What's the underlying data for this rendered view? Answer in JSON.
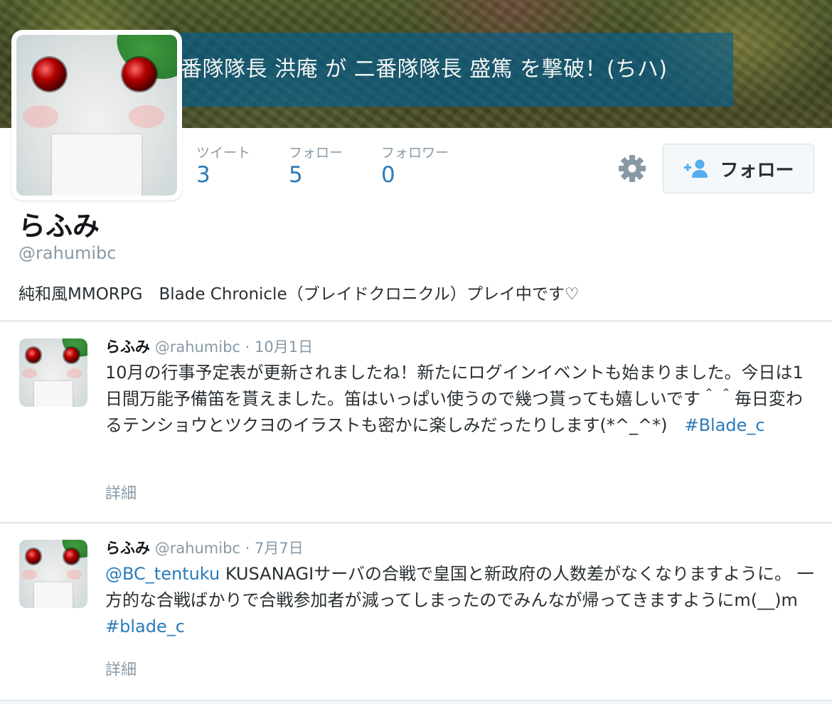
{
  "banner": {
    "message": "番隊隊長  洪庵 が 二番隊隊長  盛篤 を撃破！(ちハ)"
  },
  "profile": {
    "avatar_icon": "character-avatar",
    "stats": [
      {
        "label": "ツイート",
        "value": "3"
      },
      {
        "label": "フォロー",
        "value": "5"
      },
      {
        "label": "フォロワー",
        "value": "0"
      }
    ],
    "settings_icon": "gear-icon",
    "follow_button": {
      "icon": "add-user-icon",
      "label": "フォロー"
    },
    "name": "らふみ",
    "handle": "@rahumibc",
    "bio": "純和風MMORPG　Blade Chronicle（ブレイドクロニクル）プレイ中です♡"
  },
  "tweets": [
    {
      "name": "らふみ",
      "handle": "@rahumibc",
      "separator": "·",
      "date": "10月1日",
      "text": "10月の行事予定表が更新されましたね！新たにログインイベントも始まりました。今日は1日間万能予備笛を貰えました。笛はいっぱい使うので幾つ貰っても嬉しいです＾＾毎日変わるテンショウとツクヨのイラストも密かに楽しみだったりします(*^_^*)　",
      "hashtag": "#Blade_c",
      "details": "詳細"
    },
    {
      "name": "らふみ",
      "handle": "@rahumibc",
      "separator": "·",
      "date": "7月7日",
      "mention": "@BC_tentuku",
      "text": " KUSANAGIサーバの合戦で皇国と新政府の人数差がなくなりますように。 一方的な合戦ばかりで合戦参加者が減ってしまったのでみんなが帰ってきますようにm(__)m　",
      "hashtag": "#blade_c",
      "details": "詳細"
    }
  ],
  "colors": {
    "link": "#2b7bb9",
    "muted": "#8899a6",
    "background": "#f5f8fa"
  }
}
